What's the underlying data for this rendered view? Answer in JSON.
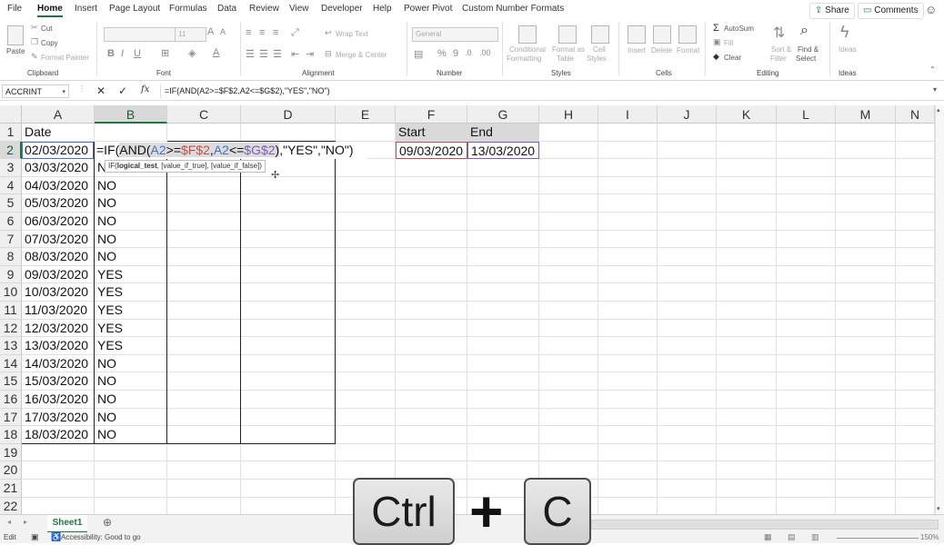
{
  "menu": {
    "tabs": [
      "File",
      "Home",
      "Insert",
      "Page Layout",
      "Formulas",
      "Data",
      "Review",
      "View",
      "Developer",
      "Help",
      "Power Pivot",
      "Custom Number Formats"
    ],
    "active": "Home",
    "share": "Share",
    "comments": "Comments"
  },
  "ribbon": {
    "clipboard": {
      "paste": "Paste",
      "cut": "Cut",
      "copy": "Copy",
      "format_painter": "Format Painter",
      "label": "Clipboard"
    },
    "font": {
      "name": "",
      "size": "11",
      "label": "Font"
    },
    "alignment": {
      "wrap": "Wrap Text",
      "merge": "Merge & Center",
      "label": "Alignment"
    },
    "number": {
      "format": "General",
      "label": "Number"
    },
    "styles": {
      "conditional": "Conditional",
      "conditional2": "Formatting",
      "format_as": "Format as",
      "format_as2": "Table",
      "cell": "Cell",
      "cell2": "Styles",
      "label": "Styles"
    },
    "cells": {
      "insert": "Insert",
      "delete": "Delete",
      "format": "Format",
      "label": "Cells"
    },
    "editing": {
      "autosum": "AutoSum",
      "fill": "Fill",
      "clear": "Clear",
      "sort": "Sort &",
      "sort2": "Filter",
      "find": "Find &",
      "find2": "Select",
      "label": "Editing"
    },
    "ideas": {
      "ideas": "Ideas",
      "label": "Ideas"
    }
  },
  "formula_bar": {
    "name_box": "ACCRINT",
    "formula": "=IF(AND(A2>=$F$2,A2<=$G$2),\"YES\",\"NO\")"
  },
  "sheet": {
    "columns": [
      "A",
      "B",
      "C",
      "D",
      "E",
      "F",
      "G",
      "H",
      "I",
      "J",
      "K",
      "L",
      "M",
      "N"
    ],
    "rows": [
      "1",
      "2",
      "3",
      "4",
      "5",
      "6",
      "7",
      "8",
      "9",
      "10",
      "11",
      "12",
      "13",
      "14",
      "15",
      "16",
      "17",
      "18",
      "19",
      "20",
      "21",
      "22"
    ],
    "a_values": [
      "Date",
      "02/03/2020",
      "03/03/2020",
      "04/03/2020",
      "05/03/2020",
      "06/03/2020",
      "07/03/2020",
      "08/03/2020",
      "09/03/2020",
      "10/03/2020",
      "11/03/2020",
      "12/03/2020",
      "13/03/2020",
      "14/03/2020",
      "15/03/2020",
      "16/03/2020",
      "17/03/2020",
      "18/03/2020"
    ],
    "b_values": [
      "",
      "",
      "N",
      "NO",
      "NO",
      "NO",
      "NO",
      "NO",
      "YES",
      "YES",
      "YES",
      "YES",
      "YES",
      "NO",
      "NO",
      "NO",
      "NO",
      "NO"
    ],
    "edit_formula": {
      "eq_if": "=IF(",
      "and": "AND(",
      "a2_1": "A2",
      ">=": ">=",
      "f2": "$F$2",
      ",": ",",
      "a2_2": "A2",
      "<=": "<=",
      "g2": "$G$2",
      ")": ")",
      "rest": ",\"YES\",\"NO\")"
    },
    "tooltip": {
      "fn": "IF(",
      "arg1": "logical_test",
      ", rest": ", [value_if_true], [value_if_false])"
    },
    "f1": "Start",
    "g1": "End",
    "f2": "09/03/2020",
    "g2": "13/03/2020"
  },
  "sheet_tabs": [
    "Sheet1"
  ],
  "status": {
    "mode": "Edit",
    "accessibility": "Accessibility: Good to go",
    "zoom": "150%"
  },
  "keys": {
    "ctrl": "Ctrl",
    "plus": "+",
    "c": "C"
  },
  "colors": {
    "accent": "#217346",
    "f_ref": "#c0504d",
    "g_ref": "#7a60b5",
    "a_ref": "#4472c4"
  }
}
